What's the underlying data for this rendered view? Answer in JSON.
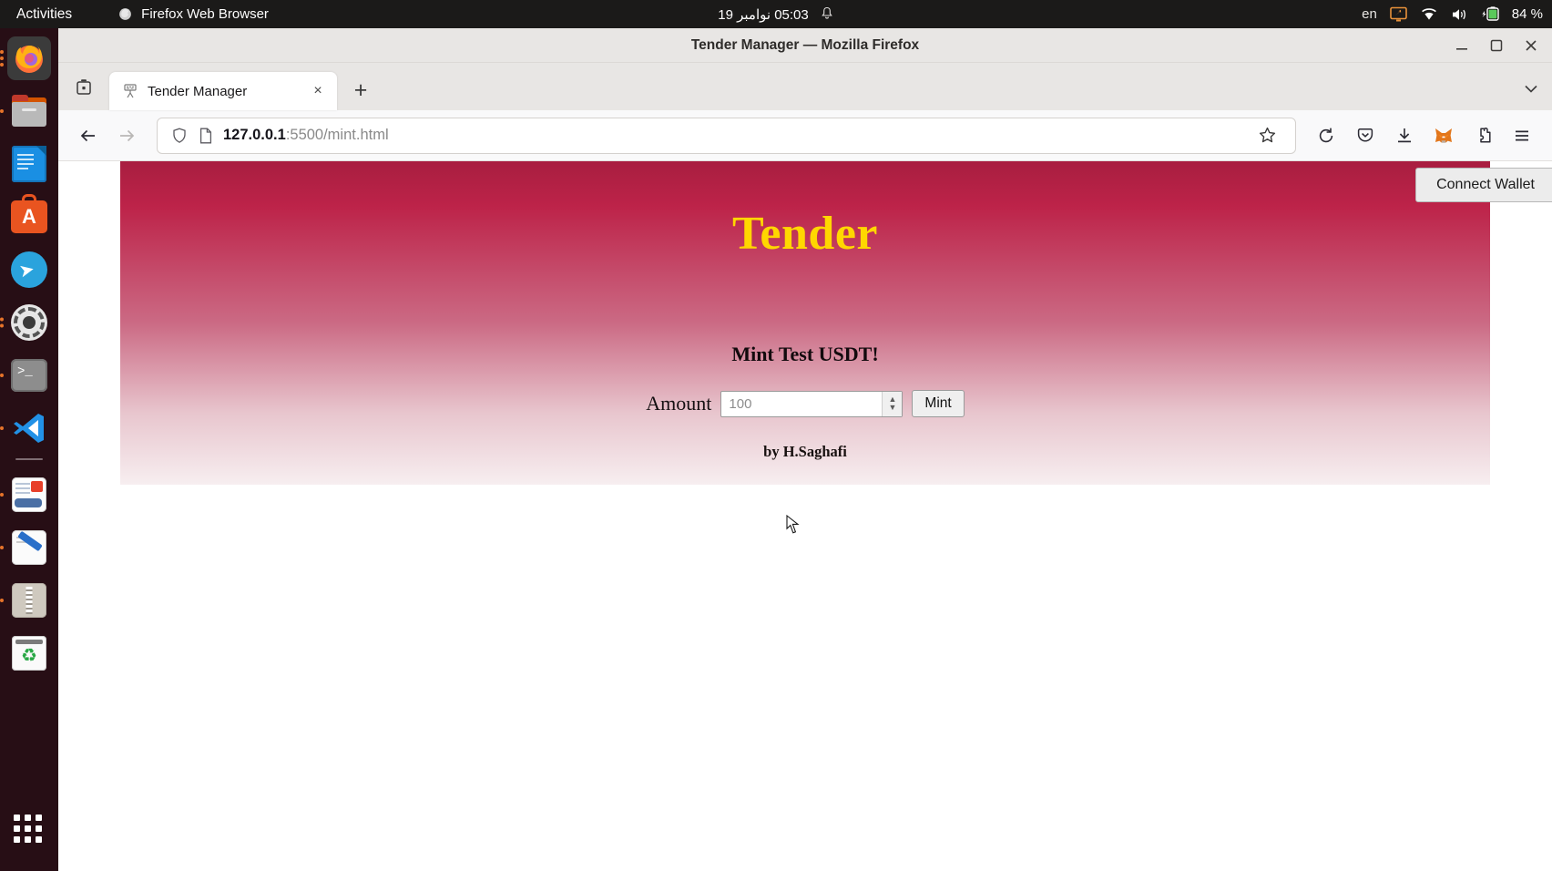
{
  "desktop": {
    "activities_label": "Activities",
    "app_menu_label": "Firefox Web Browser",
    "clock": "05:03 نوامبر 19",
    "keyboard_layout": "en",
    "battery_percent": "84 %",
    "tray_icons": [
      "screencast-icon",
      "wifi-icon",
      "volume-icon",
      "battery-icon"
    ],
    "dock_items": [
      {
        "name": "firefox",
        "label": "Firefox"
      },
      {
        "name": "files",
        "label": "Files"
      },
      {
        "name": "libreoffice-writer",
        "label": "LibreOffice Writer"
      },
      {
        "name": "ubuntu-software",
        "label": "Ubuntu Software",
        "glyph": "A"
      },
      {
        "name": "telegram",
        "label": "Telegram"
      },
      {
        "name": "settings",
        "label": "Settings"
      },
      {
        "name": "terminal",
        "label": "Terminal"
      },
      {
        "name": "vscode",
        "label": "Visual Studio Code"
      },
      {
        "name": "document-viewer",
        "label": "Document Viewer"
      },
      {
        "name": "text-editor",
        "label": "Text Editor"
      },
      {
        "name": "archive-manager",
        "label": "Archive Manager"
      },
      {
        "name": "trash",
        "label": "Trash"
      }
    ],
    "show_applications_label": "Show Applications"
  },
  "window": {
    "title": "Tender Manager — Mozilla Firefox",
    "minimize_label": "Minimize",
    "maximize_label": "Restore",
    "close_label": "Close"
  },
  "tabs": {
    "list_all_tabs_label": "List all tabs",
    "items": [
      {
        "title": "Tender Manager",
        "favicon": "broken-page-icon",
        "close_label": "×"
      }
    ],
    "new_tab_label": "+",
    "tab_actions_label": "⌄"
  },
  "navigation": {
    "back_label": "←",
    "forward_label": "→",
    "shield_icon": "tracking-protection-icon",
    "page_icon": "page-info-icon",
    "url_host": "127.0.0.1",
    "url_path": ":5500/mint.html",
    "bookmark_label": "☆",
    "reload_label": "⟳",
    "pocket_label": "Save to Pocket",
    "downloads_label": "Downloads",
    "extension_label": "MetaMask",
    "extensions_label": "Extensions",
    "menu_label": "Open application menu"
  },
  "page": {
    "connect_wallet_label": "Connect Wallet",
    "brand": "Tender",
    "mint_heading": "Mint Test USDT!",
    "amount_label": "Amount",
    "amount_placeholder": "100",
    "amount_value": "",
    "mint_button_label": "Mint",
    "byline": "by H.Saghafi"
  },
  "colors": {
    "hero_top": "#a81e40",
    "hero_mid": "#cb6a84",
    "hero_bottom": "#f7eef0",
    "brand_gold": "#ffd700",
    "topbar_bg": "#1b1a19",
    "dock_bg": "#2b0e17"
  }
}
